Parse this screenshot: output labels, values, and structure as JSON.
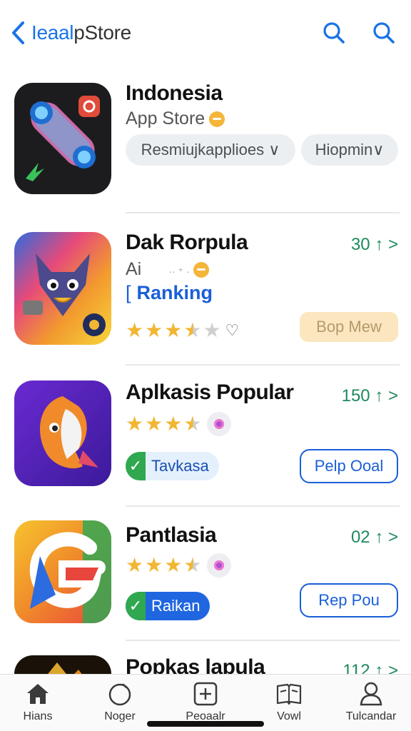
{
  "header": {
    "title_prefix": "Ieaal",
    "title_rest": "pStore",
    "back_icon": "chevron-left-icon",
    "icons": [
      "search-icon",
      "search-icon"
    ]
  },
  "apps": [
    {
      "title": "Indonesia",
      "subtitle": "App Store",
      "pills": [
        "Resmiujkapplioes ∨",
        "Hiopmin∨"
      ]
    },
    {
      "title": "Dak Rorpula",
      "subtitle": "Ai",
      "count": "30 ↑ >",
      "ranking": "Ranking",
      "rating": 3.5,
      "button": "Bop Mew"
    },
    {
      "title": "Aplkasis Popular",
      "count": "150 ↑ >",
      "rating": 3.5,
      "tag": "Tavkasa",
      "button": "Pelp Ooal"
    },
    {
      "title": "Pantlasia",
      "count": "02 ↑ >",
      "rating": 3.5,
      "tag": "Raikan",
      "button": "Rep Pou"
    },
    {
      "title": "Popkas lapula",
      "count": "112 ↑ >"
    }
  ],
  "bottom_nav": [
    {
      "label": "Hians",
      "icon": "home-icon"
    },
    {
      "label": "Noger",
      "icon": "circle-icon"
    },
    {
      "label": "Peoaalr",
      "icon": "plus-square-icon"
    },
    {
      "label": "Vowl",
      "icon": "book-icon"
    },
    {
      "label": "Tulcandar",
      "icon": "person-icon"
    }
  ],
  "colors": {
    "accent": "#1a73e8",
    "count_green": "#1e8a5c",
    "star": "#f2b632"
  }
}
